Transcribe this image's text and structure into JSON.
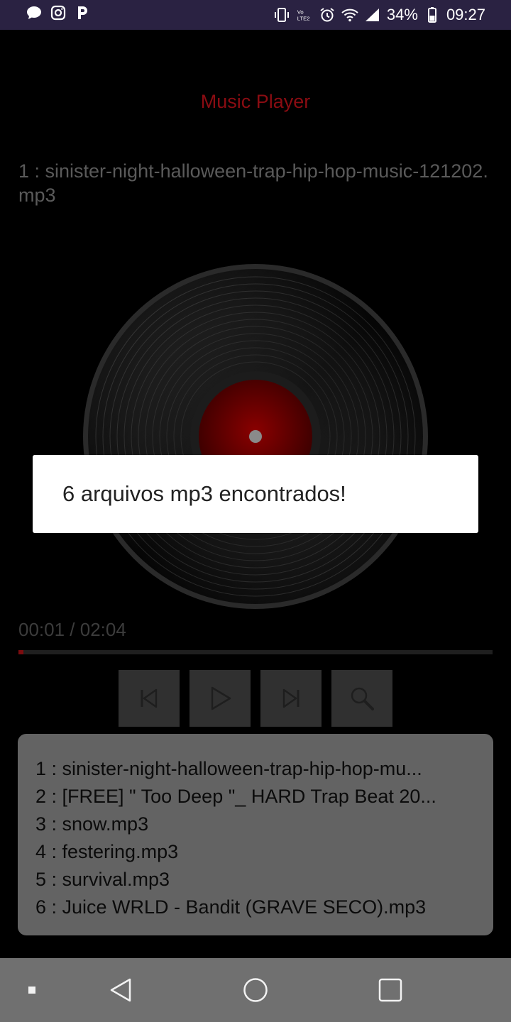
{
  "status_bar": {
    "battery": "34%",
    "time": "09:27"
  },
  "app": {
    "title": "Music Player",
    "now_playing": "1 : sinister-night-halloween-trap-hip-hop-music-121202.mp3",
    "time_display": "00:01 / 02:04",
    "progress": 0.01,
    "playlist": [
      "1 : sinister-night-halloween-trap-hip-hop-mu...",
      "2 : [FREE] \" Too Deep \"_ HARD Trap Beat 20...",
      "3 : snow.mp3",
      "4 : festering.mp3",
      "5 : survival.mp3",
      "6 : Juice WRLD - Bandit (GRAVE SECO).mp3"
    ]
  },
  "toast": {
    "message": "6 arquivos mp3 encontrados!"
  },
  "icons": {
    "previous": "skip-previous-icon",
    "play": "play-icon",
    "next": "skip-next-icon",
    "search": "search-icon"
  },
  "colors": {
    "accent": "#8a0c12",
    "status_bar": "#2a2242",
    "nav_bar": "#707070"
  }
}
